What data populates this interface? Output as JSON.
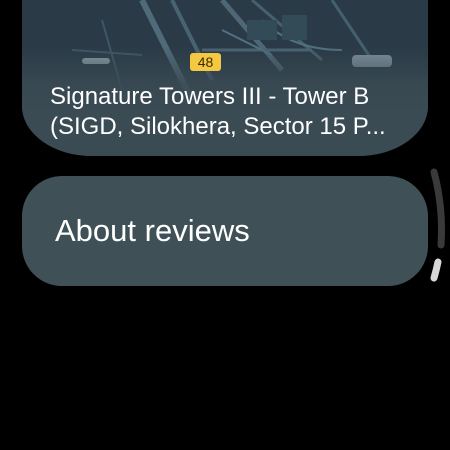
{
  "map": {
    "road_badge": "48"
  },
  "place": {
    "title_line1": "Signature Towers III - Tower B",
    "title_line2": "(SIGD, Silokhera, Sector 15 P..."
  },
  "actions": {
    "about_reviews_label": "About reviews"
  },
  "colors": {
    "background": "#000000",
    "chip_background": "#3f5157",
    "map_base": "#2b3b47",
    "road_badge": "#f5c842",
    "text": "#ffffff"
  }
}
